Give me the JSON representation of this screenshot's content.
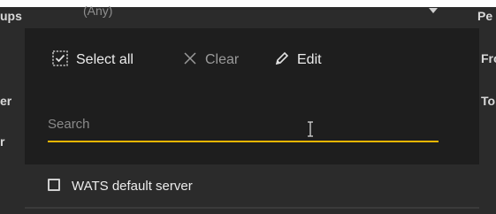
{
  "background": {
    "dropdown_value": "(Any)",
    "left_labels": [
      "ups",
      "er",
      "r"
    ],
    "right_labels": [
      "Pe",
      "Fro",
      "To"
    ]
  },
  "toolbar": {
    "select_all_label": "Select all",
    "clear_label": "Clear",
    "edit_label": "Edit"
  },
  "search": {
    "placeholder": "Search",
    "value": ""
  },
  "options": [
    {
      "label": "WATS default server",
      "checked": false
    }
  ],
  "colors": {
    "panel_bg": "#1e1e1e",
    "app_bg": "#2b2b2b",
    "accent_underline": "#f2b600",
    "text": "#ececec"
  },
  "icons": {
    "select_all": "checkbox-select-all-icon",
    "clear": "close-icon",
    "edit": "pencil-icon",
    "dropdown": "caret-down-icon",
    "cursor": "text-cursor-icon"
  }
}
